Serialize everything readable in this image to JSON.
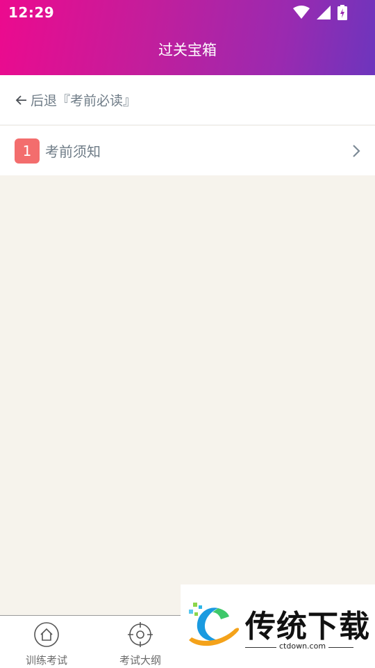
{
  "status_bar": {
    "time": "12:29"
  },
  "header": {
    "title": "过关宝箱"
  },
  "nav": {
    "back_label": "后退『考前必读』"
  },
  "list": {
    "items": [
      {
        "number": "1",
        "label": "考前须知"
      }
    ]
  },
  "tabbar": {
    "tabs": [
      {
        "label": "训练考试",
        "icon": "home-icon"
      },
      {
        "label": "考试大纲",
        "icon": "target-icon"
      }
    ]
  },
  "watermark": {
    "text": "传统下载",
    "url": "ctdown.com"
  },
  "colors": {
    "header_gradient_start": "#ec0a8e",
    "header_gradient_end": "#6d35bd",
    "badge": "#f36d6d",
    "text_muted": "#6f7c87",
    "background": "#f6f3ec"
  }
}
